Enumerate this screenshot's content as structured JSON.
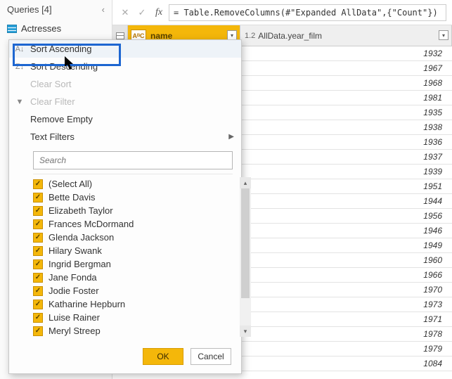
{
  "sidebar": {
    "title": "Queries [4]",
    "items": [
      {
        "label": "Actresses"
      }
    ]
  },
  "formula_bar": {
    "value": "= Table.RemoveColumns(#\"Expanded AllData\",{\"Count\"})"
  },
  "columns": {
    "c1": {
      "type_badge": "AᴮC",
      "label": "name"
    },
    "c2": {
      "type_badge": "1.2",
      "label": "AllData.year_film"
    }
  },
  "rows": [
    "1932",
    "1967",
    "1968",
    "1981",
    "1935",
    "1938",
    "1936",
    "1937",
    "1939",
    "1951",
    "1944",
    "1956",
    "1946",
    "1949",
    "1960",
    "1966",
    "1970",
    "1973",
    "1971",
    "1978",
    "1979",
    "1084"
  ],
  "menu": {
    "sort_asc": "Sort Ascending",
    "sort_desc": "Sort Descending",
    "clear_sort": "Clear Sort",
    "clear_filter": "Clear Filter",
    "remove_empty": "Remove Empty",
    "text_filters": "Text Filters",
    "search_placeholder": "Search",
    "options": [
      "(Select All)",
      "Bette Davis",
      "Elizabeth Taylor",
      "Frances McDormand",
      "Glenda Jackson",
      "Hilary Swank",
      "Ingrid Bergman",
      "Jane Fonda",
      "Jodie Foster",
      "Katharine Hepburn",
      "Luise Rainer",
      "Meryl Streep"
    ],
    "ok": "OK",
    "cancel": "Cancel"
  }
}
